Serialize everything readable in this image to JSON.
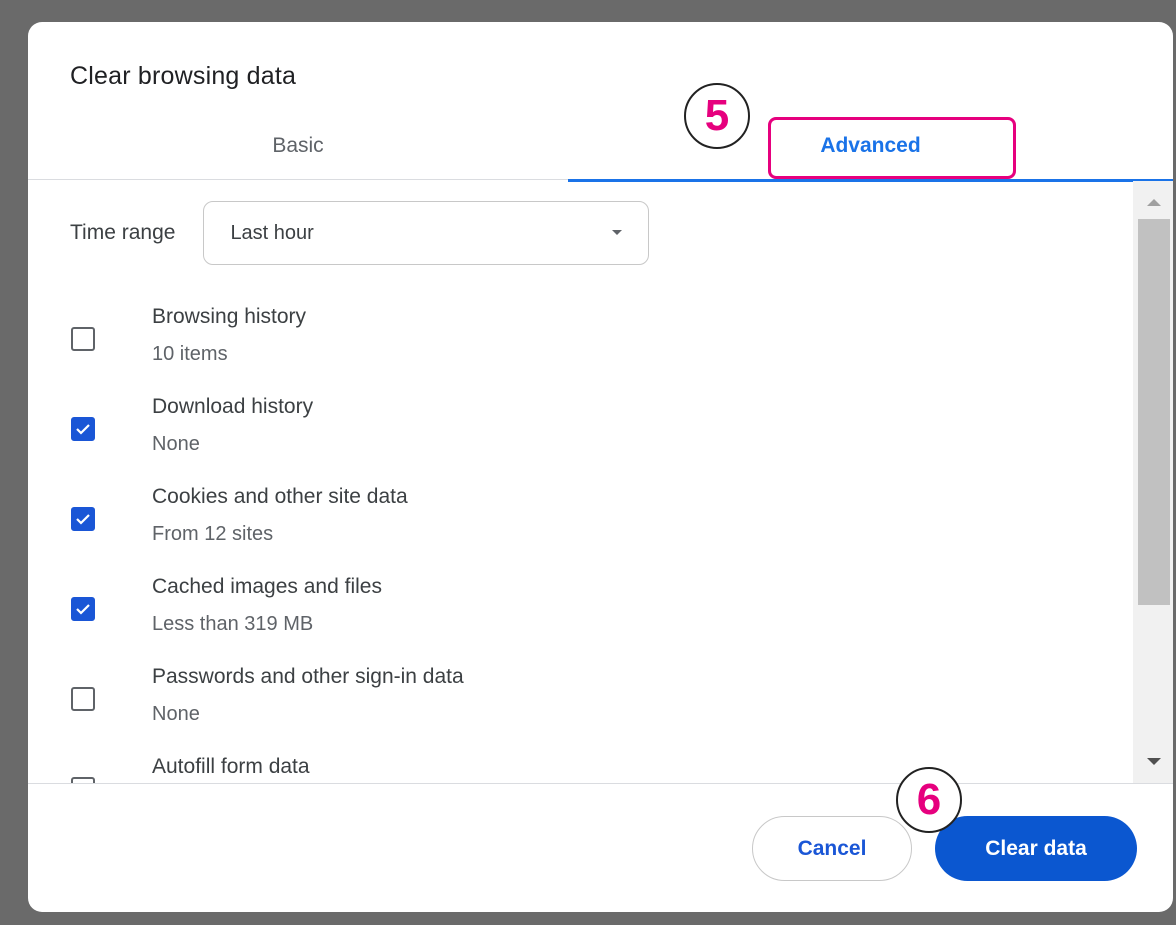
{
  "dialog": {
    "title": "Clear browsing data"
  },
  "tabs": {
    "basic": "Basic",
    "advanced": "Advanced",
    "active": "advanced"
  },
  "time_range": {
    "label": "Time range",
    "value": "Last hour"
  },
  "items": [
    {
      "title": "Browsing history",
      "subtitle": "10 items",
      "checked": false
    },
    {
      "title": "Download history",
      "subtitle": "None",
      "checked": true
    },
    {
      "title": "Cookies and other site data",
      "subtitle": "From 12 sites",
      "checked": true
    },
    {
      "title": "Cached images and files",
      "subtitle": "Less than 319 MB",
      "checked": true
    },
    {
      "title": "Passwords and other sign-in data",
      "subtitle": "None",
      "checked": false
    },
    {
      "title": "Autofill form data",
      "subtitle": "",
      "checked": false
    }
  ],
  "footer": {
    "cancel_label": "Cancel",
    "clear_label": "Clear data"
  },
  "annotations": {
    "step_5": "5",
    "step_6": "6"
  },
  "colors": {
    "accent": "#1a73e8",
    "primary_button": "#0b57d0",
    "annotation": "#e6007e"
  }
}
